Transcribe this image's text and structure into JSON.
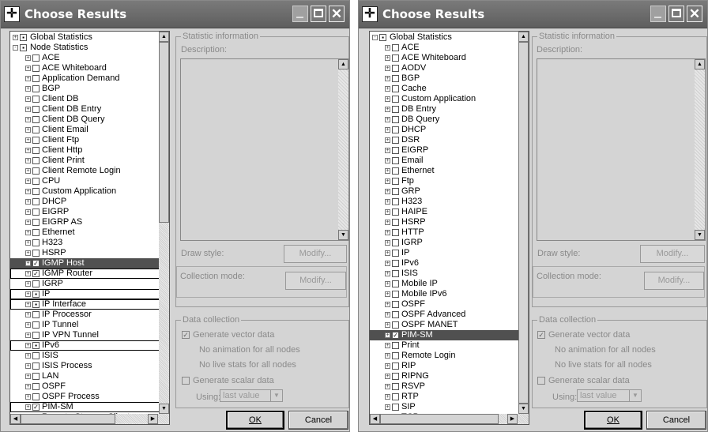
{
  "windows": [
    {
      "title": "Choose Results",
      "tree": [
        {
          "label": "Global Statistics",
          "level": 0,
          "expander": "+",
          "check": "▪",
          "state": ""
        },
        {
          "label": "Node Statistics",
          "level": 0,
          "expander": "-",
          "check": "▪",
          "state": ""
        },
        {
          "label": "ACE",
          "level": 1,
          "expander": "+",
          "check": "",
          "state": ""
        },
        {
          "label": "ACE Whiteboard",
          "level": 1,
          "expander": "+",
          "check": "",
          "state": ""
        },
        {
          "label": "Application Demand",
          "level": 1,
          "expander": "+",
          "check": "",
          "state": ""
        },
        {
          "label": "BGP",
          "level": 1,
          "expander": "+",
          "check": "",
          "state": ""
        },
        {
          "label": "Client DB",
          "level": 1,
          "expander": "+",
          "check": "",
          "state": ""
        },
        {
          "label": "Client DB Entry",
          "level": 1,
          "expander": "+",
          "check": "",
          "state": ""
        },
        {
          "label": "Client DB Query",
          "level": 1,
          "expander": "+",
          "check": "",
          "state": ""
        },
        {
          "label": "Client Email",
          "level": 1,
          "expander": "+",
          "check": "",
          "state": ""
        },
        {
          "label": "Client Ftp",
          "level": 1,
          "expander": "+",
          "check": "",
          "state": ""
        },
        {
          "label": "Client Http",
          "level": 1,
          "expander": "+",
          "check": "",
          "state": ""
        },
        {
          "label": "Client Print",
          "level": 1,
          "expander": "+",
          "check": "",
          "state": ""
        },
        {
          "label": "Client Remote Login",
          "level": 1,
          "expander": "+",
          "check": "",
          "state": ""
        },
        {
          "label": "CPU",
          "level": 1,
          "expander": "+",
          "check": "",
          "state": ""
        },
        {
          "label": "Custom Application",
          "level": 1,
          "expander": "+",
          "check": "",
          "state": ""
        },
        {
          "label": "DHCP",
          "level": 1,
          "expander": "+",
          "check": "",
          "state": ""
        },
        {
          "label": "EIGRP",
          "level": 1,
          "expander": "+",
          "check": "",
          "state": ""
        },
        {
          "label": "EIGRP AS",
          "level": 1,
          "expander": "+",
          "check": "",
          "state": ""
        },
        {
          "label": "Ethernet",
          "level": 1,
          "expander": "+",
          "check": "",
          "state": ""
        },
        {
          "label": "H323",
          "level": 1,
          "expander": "+",
          "check": "",
          "state": ""
        },
        {
          "label": "HSRP",
          "level": 1,
          "expander": "+",
          "check": "",
          "state": ""
        },
        {
          "label": "IGMP Host",
          "level": 1,
          "expander": "+",
          "check": "✓",
          "state": "sel"
        },
        {
          "label": "IGMP Router",
          "level": 1,
          "expander": "+",
          "check": "✓",
          "state": "boxed"
        },
        {
          "label": "IGRP",
          "level": 1,
          "expander": "+",
          "check": "",
          "state": ""
        },
        {
          "label": "IP",
          "level": 1,
          "expander": "+",
          "check": "▪",
          "state": "boxed"
        },
        {
          "label": "IP Interface",
          "level": 1,
          "expander": "+",
          "check": "▪",
          "state": "boxed"
        },
        {
          "label": "IP Processor",
          "level": 1,
          "expander": "+",
          "check": "",
          "state": ""
        },
        {
          "label": "IP Tunnel",
          "level": 1,
          "expander": "+",
          "check": "",
          "state": ""
        },
        {
          "label": "IP VPN Tunnel",
          "level": 1,
          "expander": "+",
          "check": "",
          "state": ""
        },
        {
          "label": "IPv6",
          "level": 1,
          "expander": "+",
          "check": "▪",
          "state": "boxed"
        },
        {
          "label": "ISIS",
          "level": 1,
          "expander": "+",
          "check": "",
          "state": ""
        },
        {
          "label": "ISIS Process",
          "level": 1,
          "expander": "+",
          "check": "",
          "state": ""
        },
        {
          "label": "LAN",
          "level": 1,
          "expander": "+",
          "check": "",
          "state": ""
        },
        {
          "label": "OSPF",
          "level": 1,
          "expander": "+",
          "check": "",
          "state": ""
        },
        {
          "label": "OSPF Process",
          "level": 1,
          "expander": "+",
          "check": "",
          "state": ""
        },
        {
          "label": "PIM-SM",
          "level": 1,
          "expander": "+",
          "check": "✓",
          "state": "boxed"
        },
        {
          "label": "Remote Storage Client",
          "level": 1,
          "expander": "+",
          "check": "",
          "state": ""
        }
      ],
      "scroll": {
        "thumb_fraction": 0.5
      }
    },
    {
      "title": "Choose Results",
      "tree": [
        {
          "label": "Global Statistics",
          "level": 0,
          "expander": "-",
          "check": "▪",
          "state": ""
        },
        {
          "label": "ACE",
          "level": 1,
          "expander": "+",
          "check": "",
          "state": ""
        },
        {
          "label": "ACE Whiteboard",
          "level": 1,
          "expander": "+",
          "check": "",
          "state": ""
        },
        {
          "label": "AODV",
          "level": 1,
          "expander": "+",
          "check": "",
          "state": ""
        },
        {
          "label": "BGP",
          "level": 1,
          "expander": "+",
          "check": "",
          "state": ""
        },
        {
          "label": "Cache",
          "level": 1,
          "expander": "+",
          "check": "",
          "state": ""
        },
        {
          "label": "Custom Application",
          "level": 1,
          "expander": "+",
          "check": "",
          "state": ""
        },
        {
          "label": "DB Entry",
          "level": 1,
          "expander": "+",
          "check": "",
          "state": ""
        },
        {
          "label": "DB Query",
          "level": 1,
          "expander": "+",
          "check": "",
          "state": ""
        },
        {
          "label": "DHCP",
          "level": 1,
          "expander": "+",
          "check": "",
          "state": ""
        },
        {
          "label": "DSR",
          "level": 1,
          "expander": "+",
          "check": "",
          "state": ""
        },
        {
          "label": "EIGRP",
          "level": 1,
          "expander": "+",
          "check": "",
          "state": ""
        },
        {
          "label": "Email",
          "level": 1,
          "expander": "+",
          "check": "",
          "state": ""
        },
        {
          "label": "Ethernet",
          "level": 1,
          "expander": "+",
          "check": "",
          "state": ""
        },
        {
          "label": "Ftp",
          "level": 1,
          "expander": "+",
          "check": "",
          "state": ""
        },
        {
          "label": "GRP",
          "level": 1,
          "expander": "+",
          "check": "",
          "state": ""
        },
        {
          "label": "H323",
          "level": 1,
          "expander": "+",
          "check": "",
          "state": ""
        },
        {
          "label": "HAIPE",
          "level": 1,
          "expander": "+",
          "check": "",
          "state": ""
        },
        {
          "label": "HSRP",
          "level": 1,
          "expander": "+",
          "check": "",
          "state": ""
        },
        {
          "label": "HTTP",
          "level": 1,
          "expander": "+",
          "check": "",
          "state": ""
        },
        {
          "label": "IGRP",
          "level": 1,
          "expander": "+",
          "check": "",
          "state": ""
        },
        {
          "label": "IP",
          "level": 1,
          "expander": "+",
          "check": "",
          "state": ""
        },
        {
          "label": "IPv6",
          "level": 1,
          "expander": "+",
          "check": "",
          "state": ""
        },
        {
          "label": "ISIS",
          "level": 1,
          "expander": "+",
          "check": "",
          "state": ""
        },
        {
          "label": "Mobile IP",
          "level": 1,
          "expander": "+",
          "check": "",
          "state": ""
        },
        {
          "label": "Mobile IPv6",
          "level": 1,
          "expander": "+",
          "check": "",
          "state": ""
        },
        {
          "label": "OSPF",
          "level": 1,
          "expander": "+",
          "check": "",
          "state": ""
        },
        {
          "label": "OSPF Advanced",
          "level": 1,
          "expander": "+",
          "check": "",
          "state": ""
        },
        {
          "label": "OSPF MANET",
          "level": 1,
          "expander": "+",
          "check": "",
          "state": ""
        },
        {
          "label": "PIM-SM",
          "level": 1,
          "expander": "+",
          "check": "✓",
          "state": "sel"
        },
        {
          "label": "Print",
          "level": 1,
          "expander": "+",
          "check": "",
          "state": ""
        },
        {
          "label": "Remote Login",
          "level": 1,
          "expander": "+",
          "check": "",
          "state": ""
        },
        {
          "label": "RIP",
          "level": 1,
          "expander": "+",
          "check": "",
          "state": ""
        },
        {
          "label": "RIPNG",
          "level": 1,
          "expander": "+",
          "check": "",
          "state": ""
        },
        {
          "label": "RSVP",
          "level": 1,
          "expander": "+",
          "check": "",
          "state": ""
        },
        {
          "label": "RTP",
          "level": 1,
          "expander": "+",
          "check": "",
          "state": ""
        },
        {
          "label": "SIP",
          "level": 1,
          "expander": "+",
          "check": "",
          "state": ""
        },
        {
          "label": "TCP",
          "level": 1,
          "expander": "+",
          "check": "",
          "state": ""
        }
      ],
      "scroll": {
        "thumb_fraction": 1.0
      }
    }
  ],
  "panel": {
    "stat_info_title": "Statistic information",
    "description_label": "Description:",
    "draw_style_label": "Draw style:",
    "collection_mode_label": "Collection mode:",
    "modify_label": "Modify...",
    "data_collection_title": "Data collection",
    "generate_vector_label": "Generate vector data",
    "no_animation_label": "No animation for all nodes",
    "no_live_stats_label": "No live stats for all nodes",
    "generate_scalar_label": "Generate scalar data",
    "using_label": "Using:",
    "using_value": "last value",
    "ok_label": "OK",
    "cancel_label": "Cancel"
  },
  "icons": {
    "title": "crosshair-icon",
    "minimize": "minimize-icon",
    "maximize": "maximize-icon",
    "close": "close-icon"
  }
}
